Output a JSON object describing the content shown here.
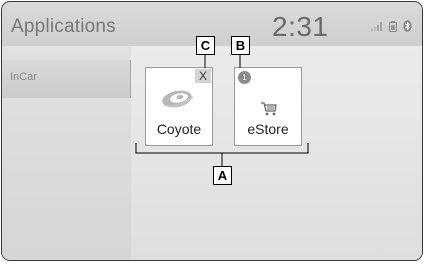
{
  "header": {
    "title": "Applications",
    "time": "2:31"
  },
  "sidebar": {
    "items": [
      {
        "label": "InCar"
      }
    ]
  },
  "apps": [
    {
      "label": "Coyote",
      "badge": "X",
      "icon": "coyote-logo"
    },
    {
      "label": "eStore",
      "badge": "1",
      "icon": "cart-icon"
    }
  ],
  "callouts": {
    "a": "A",
    "b": "B",
    "c": "C"
  }
}
